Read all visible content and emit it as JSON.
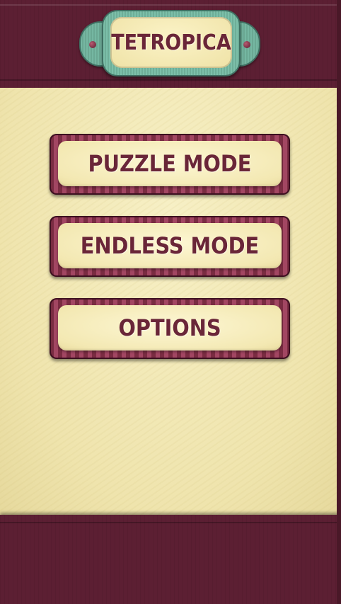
{
  "title": "TETROPICA",
  "menu": {
    "puzzle_mode": "PUZZLE MODE",
    "endless_mode": "ENDLESS MODE",
    "options": "OPTIONS"
  },
  "colors": {
    "maroon": "#5c1f33",
    "cream": "#f3eab5",
    "teal": "#7cbfa9",
    "text": "#6a2638"
  }
}
